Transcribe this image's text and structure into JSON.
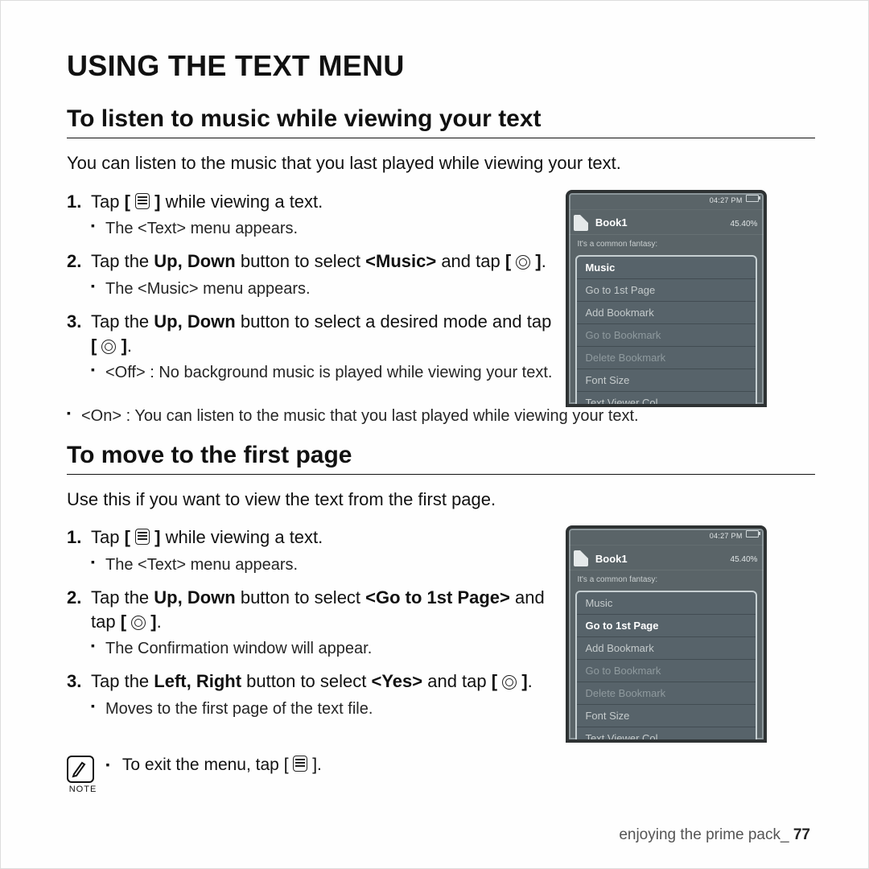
{
  "page": {
    "h1": "USING THE TEXT MENU",
    "footer_label": "enjoying the prime pack_",
    "footer_page": "77"
  },
  "icons": {
    "menu_name": "menu-icon",
    "ok_name": "ok-ring-icon",
    "note_name": "note-pencil-icon",
    "doc_name": "document-icon",
    "battery_name": "battery-icon"
  },
  "section1": {
    "h2": "To listen to music while viewing your text",
    "intro": "You can listen to the music that you last played while viewing your text.",
    "step1a": "Tap ",
    "step1b": " while viewing a text.",
    "step1_sub1": "The <Text> menu appears.",
    "step2a": "Tap the ",
    "step2b": "Up, Down",
    "step2c": " button to select ",
    "step2d": "<Music>",
    "step2e": " and tap ",
    "step2_sub1": "The <Music> menu appears.",
    "step3a": "Tap the ",
    "step3b": "Up, Down",
    "step3c": " button to select a desired mode and tap ",
    "step3_sub1": "<Off> : No background music is played while viewing your text.",
    "step3_sub2": "<On> : You can listen to the music that you last played while viewing your text."
  },
  "section2": {
    "h2": "To move to the first page",
    "intro": "Use this if you want to view the text from the first page.",
    "step1a": "Tap ",
    "step1b": " while viewing a text.",
    "step1_sub1": "The <Text> menu appears.",
    "step2a": "Tap the ",
    "step2b": "Up, Down",
    "step2c": " button to select ",
    "step2d": "<Go to 1st Page>",
    "step2e": " and tap ",
    "step2_sub1": "The Confirmation window will appear.",
    "step3a": "Tap the ",
    "step3b": "Left, Right",
    "step3c": " button to select ",
    "step3d": "<Yes>",
    "step3e": " and tap ",
    "step3_sub1": "Moves to the first page of the text file."
  },
  "note": {
    "label": "NOTE",
    "text_a": "To exit the menu, tap ",
    "text_b": "."
  },
  "device_common": {
    "status_time": "04:27 PM",
    "title": "Book1",
    "progress": "45.40%",
    "excerpt": "It's a common fantasy:",
    "items": [
      "Music",
      "Go to 1st Page",
      "Add Bookmark",
      "Go to Bookmark",
      "Delete Bookmark",
      "Font Size",
      "Text Viewer Col.."
    ]
  },
  "device1": {
    "selected_index": 0
  },
  "device2": {
    "selected_index": 1
  }
}
